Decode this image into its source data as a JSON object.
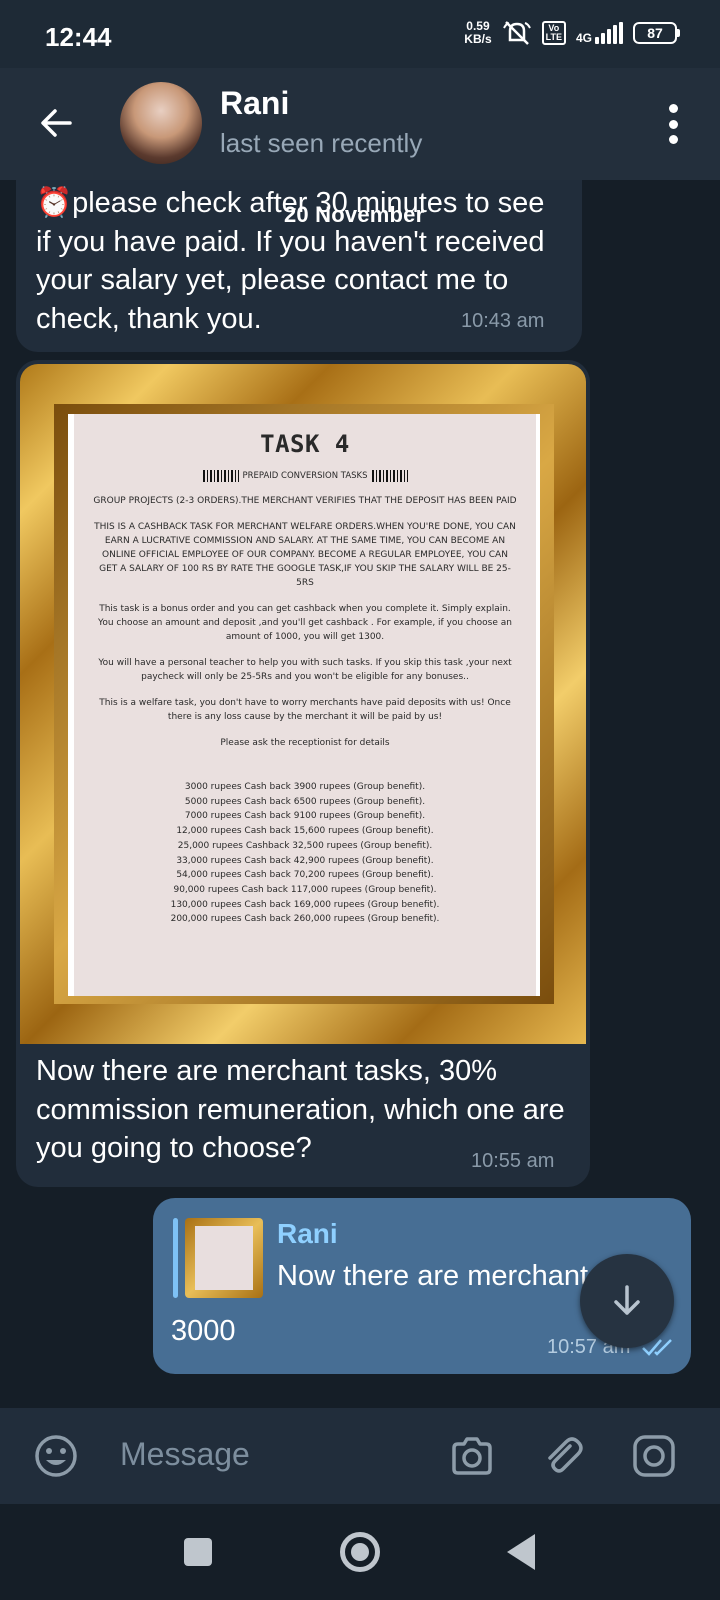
{
  "status_bar": {
    "time": "12:44",
    "net_speed_value": "0.59",
    "net_speed_unit": "KB/s",
    "lte_top": "Vo",
    "lte_bottom": "LTE",
    "network": "4G",
    "battery": "87"
  },
  "header": {
    "name": "Rani",
    "status": "last seen recently"
  },
  "chat": {
    "date_label": "20 November",
    "messages": [
      {
        "emoji": "⏰",
        "text": "please check after 30 minutes to see if you have paid. If you haven't received your salary yet, please contact me to check, thank you.",
        "time": "10:43 am"
      },
      {
        "text": "Now there are merchant tasks, 30% commission remuneration, which one are you going to choose?",
        "time": "10:55 am",
        "image": {
          "title": "TASK 4",
          "subtitle": "PREPAID CONVERSION  TASKS",
          "paragraphs": [
            "GROUP  PROJECTS (2-3 ORDERS).THE  MERCHANT  VERIFIES  THAT  THE  DEPOSIT  HAS BEEN  PAID",
            "THIS IS A CASHBACK TASK FOR MERCHANT WELFARE ORDERS.WHEN YOU'RE DONE, YOU CAN EARN A  LUCRATIVE  COMMISSION AND SALARY. AT THE SAME TIME, YOU CAN  BECOME AN ONLINE OFFICIAL  EMPLOYEE OF OUR  COMPANY. BECOME A REGULAR EMPLOYEE, YOU CAN GET A SALARY OF 100 RS BY RATE THE GOOGLE TASK,IF YOU SKIP THE SALARY WILL BE 25-5RS",
            "This task  is  a bonus order and you can  get  cashback  when you complete it. Simply explain. You choose an amount and deposit ,and you'll get cashback . For  example, if you choose an amount of 1000, you will get 1300.",
            "You will have a personal  teacher to help you with such  tasks. If you skip this task ,your next paycheck will only be 25-5Rs and  you won't be eligible for  any  bonuses..",
            "This  is a  welfare task, you don't have  to worry merchants have paid deposits with us! Once  there is any loss  cause by the merchant it will be paid by us!",
            "Please ask the receptionist  for details"
          ],
          "amounts": [
            "3000 rupees Cash back 3900 rupees (Group benefit).",
            "5000 rupees Cash back 6500 rupees (Group benefit).",
            "7000 rupees Cash back 9100 rupees (Group benefit).",
            "12,000 rupees Cash back 15,600 rupees (Group benefit).",
            "25,000 rupees Cashback 32,500 rupees (Group benefit).",
            "33,000 rupees Cash back 42,900 rupees (Group benefit).",
            "54,000 rupees Cash back 70,200 rupees (Group benefit).",
            "90,000 rupees Cash back 117,000 rupees (Group benefit).",
            "130,000 rupees Cash back 169,000 rupees (Group benefit).",
            "200,000 rupees Cash back 260,000 rupees (Group benefit)."
          ]
        }
      },
      {
        "reply_to_name": "Rani",
        "reply_to_text": "Now there are merchant",
        "text": "3000",
        "time": "10:57 am"
      }
    ]
  },
  "input": {
    "placeholder": "Message"
  },
  "icons": {
    "back": "arrow-left-icon",
    "menu": "more-vertical-icon",
    "emoji": "smile-icon",
    "camera": "camera-icon",
    "attach": "paperclip-icon",
    "video": "instagram-like-camera-icon",
    "scroll": "arrow-down-icon"
  },
  "colors": {
    "background": "#151e27",
    "header": "#232f3c",
    "incoming_bubble": "#212d3b",
    "outgoing_bubble": "#476e94",
    "accent": "#8fd0ff"
  }
}
